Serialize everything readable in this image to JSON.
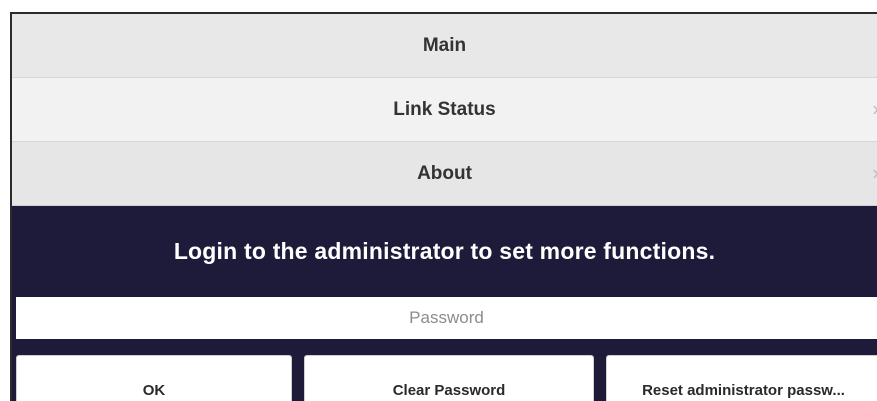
{
  "menu": {
    "items": [
      {
        "label": "Main"
      },
      {
        "label": "Link Status"
      },
      {
        "label": "About"
      }
    ]
  },
  "login": {
    "banner_text": "Login to the administrator to set more functions.",
    "password_placeholder": "Password",
    "password_value": ""
  },
  "buttons": {
    "ok_label": "OK",
    "clear_label": "Clear Password",
    "reset_label": "Reset administrator passw..."
  },
  "colors": {
    "banner_background": "#1e1b3a",
    "row_background": "#e8e8e8",
    "banner_text": "#ffffff"
  },
  "icons": {
    "row_chevron": "chevron-right-icon"
  }
}
